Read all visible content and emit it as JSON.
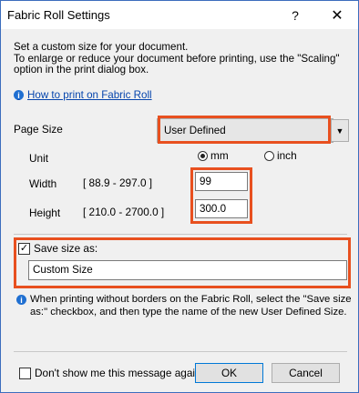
{
  "window": {
    "title": "Fabric Roll Settings",
    "help_label": "?",
    "close_label": "✕"
  },
  "intro": {
    "line1": "Set a custom size for your document.",
    "line2": "To enlarge or reduce your document before printing, use the \"Scaling\"",
    "line3": "option in the print dialog box."
  },
  "help_link": {
    "label": "How to print on Fabric Roll",
    "icon": "info-icon"
  },
  "page_size": {
    "label": "Page Size",
    "value": "User Defined"
  },
  "unit": {
    "label": "Unit",
    "options": [
      "mm",
      "inch"
    ],
    "selected": "mm"
  },
  "width": {
    "label": "Width",
    "range": "[ 88.9 - 297.0 ]",
    "value": "99"
  },
  "height": {
    "label": "Height",
    "range": "[ 210.0 - 2700.0 ]",
    "value": "300.0"
  },
  "save_size": {
    "checked": true,
    "label": "Save size as:",
    "value": "Custom Size"
  },
  "note": {
    "line1": "When printing without borders on the Fabric Roll, select the \"Save size",
    "line2": "as:\" checkbox, and then type the name of the new User Defined Size."
  },
  "footer": {
    "dont_show_label": "Don't show me this message again.",
    "dont_show_checked": false,
    "ok_label": "OK",
    "cancel_label": "Cancel"
  },
  "colors": {
    "highlight": "#e8501f",
    "accent": "#0078d7",
    "link": "#0645ad"
  }
}
